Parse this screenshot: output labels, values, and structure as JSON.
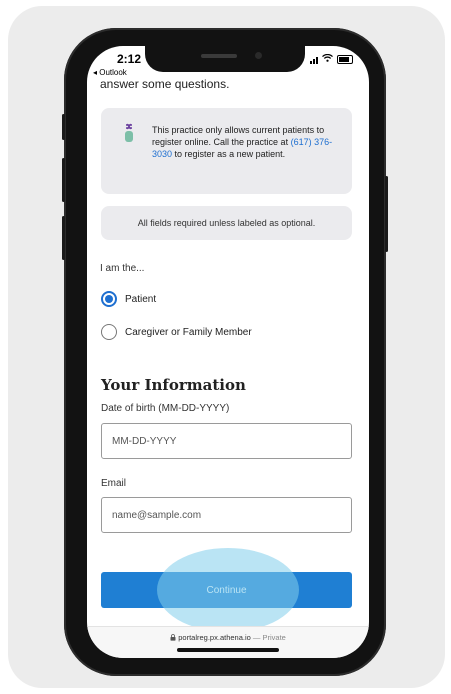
{
  "status_bar": {
    "time": "2:12",
    "back_app": "◂ Outlook"
  },
  "intro": {
    "text": "answer some questions."
  },
  "info_box": {
    "text_before": "This practice only allows current patients to register online. Call the practice at",
    "phone_link": "(617) 376-3030",
    "text_after": "to register as a new patient."
  },
  "fields_note": "All fields required unless labeled as optional.",
  "role": {
    "label": "I am the...",
    "options": [
      {
        "label": "Patient",
        "checked": true
      },
      {
        "label": "Caregiver or Family Member",
        "checked": false
      }
    ]
  },
  "your_information": {
    "title": "Your Information",
    "dob": {
      "label": "Date of birth (MM-DD-YYYY)",
      "placeholder": "MM-DD-YYYY",
      "value": ""
    },
    "email": {
      "label": "Email",
      "placeholder": "name@sample.com",
      "value": ""
    }
  },
  "continue_label": "Continue",
  "url_bar": {
    "domain": "portalreg.px.athena.io",
    "separator": " — ",
    "private_label": "Private"
  },
  "colors": {
    "accent": "#1f7fd3",
    "link": "#1e6fd0",
    "box_bg": "#ebebee"
  }
}
